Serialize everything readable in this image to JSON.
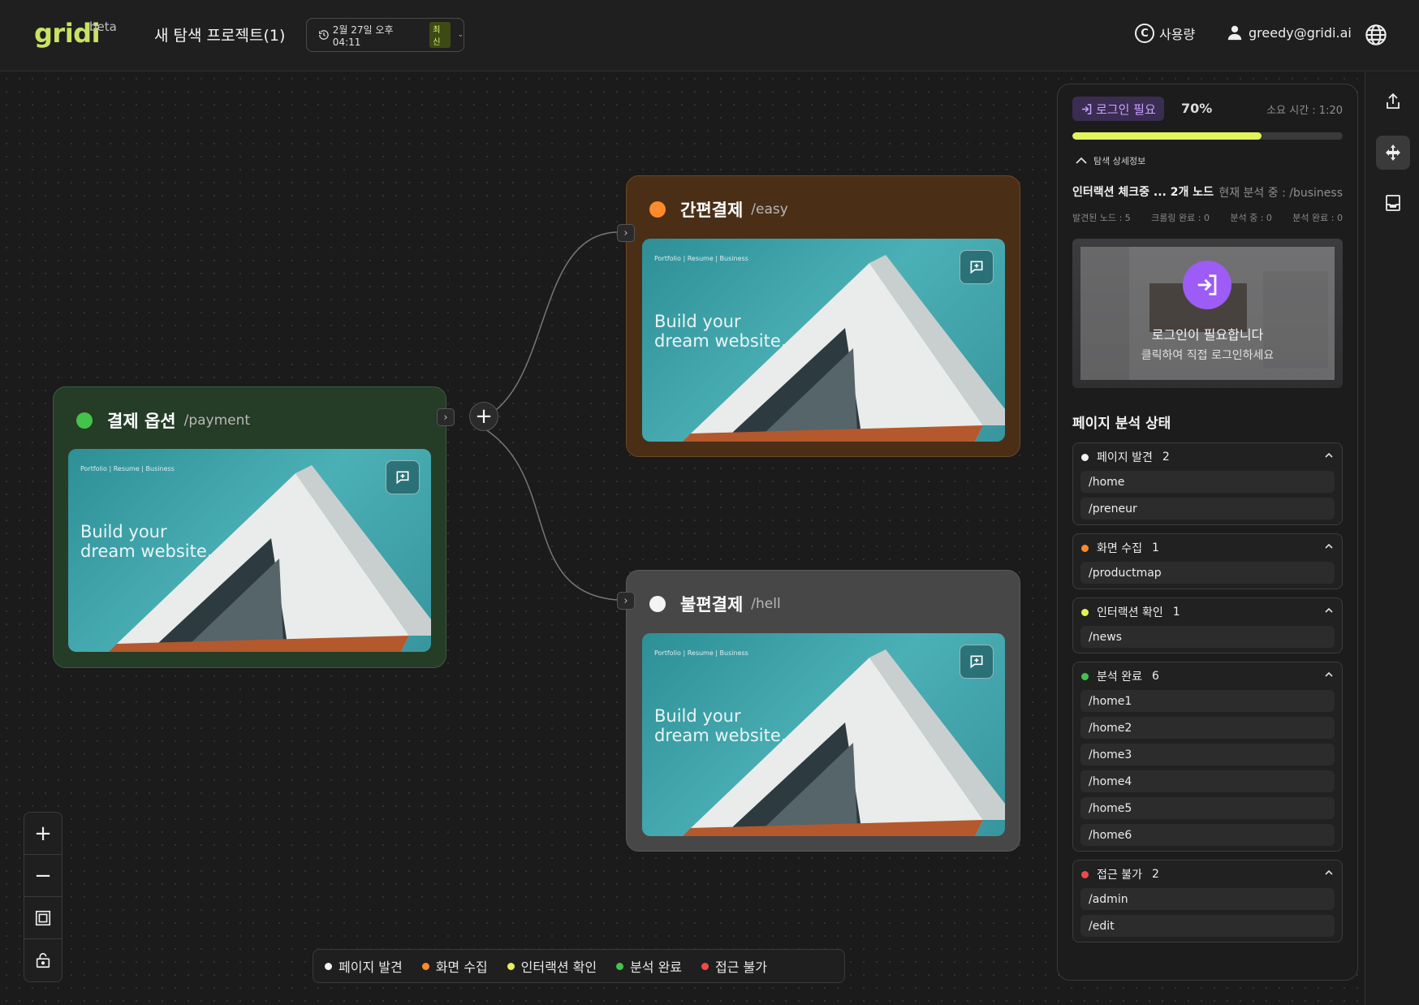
{
  "header": {
    "logo": "gridi",
    "logo_badge": "beta",
    "project_title": "새 탐색 프로젝트(1)",
    "version": {
      "datetime": "2월 27일 오후 04:11",
      "badge": "최신"
    },
    "usage_label": "사용량",
    "user_email": "greedy@gridi.ai"
  },
  "nodes": [
    {
      "id": "payment",
      "name": "결제 옵션",
      "path": "/payment",
      "status_color": "#44c24a",
      "card_color": "#253c27",
      "border_color": "#3c5a3e"
    },
    {
      "id": "easy",
      "name": "간편결제",
      "path": "/easy",
      "status_color": "#ff8a2a",
      "card_color": "#4a2f16",
      "border_color": "#6a4626"
    },
    {
      "id": "hell",
      "name": "불편결제",
      "path": "/hell",
      "status_color": "#f4f4f4",
      "card_color": "#474747",
      "border_color": "#5a5a5a"
    }
  ],
  "thumbnail": {
    "top_text": "Portfolio | Resume | Business",
    "headline": "Build your dream website."
  },
  "legend": [
    {
      "label": "페이지 발견",
      "color": "#f4f4f4"
    },
    {
      "label": "화면 수집",
      "color": "#ff8a2a"
    },
    {
      "label": "인터랙션 확인",
      "color": "#e6f05a"
    },
    {
      "label": "분석 완료",
      "color": "#44c24a"
    },
    {
      "label": "접근 불가",
      "color": "#ef4a4a"
    }
  ],
  "panel": {
    "login_tag": "로그인 필요",
    "percent": "70%",
    "progress": 0.7,
    "elapsed": "소요 시간 : 1:20",
    "detail_toggle": "탐색 상세정보",
    "status_main": "인터랙션 체크중 ... 2개 노드",
    "status_current": "현재 분석 중 : /business",
    "stats": [
      "발견된 노드 : 5",
      "크롤링 완료 : 0",
      "분석 중 : 0",
      "분석 완료 : 0"
    ],
    "login_title": "로그인이 필요합니다",
    "login_sub": "클릭하여 직접 로그인하세요",
    "section_title": "페이지 분석 상태",
    "groups": [
      {
        "label": "페이지 발견",
        "count": "2",
        "color": "#f4f4f4",
        "items": [
          "/home",
          "/preneur"
        ]
      },
      {
        "label": "화면 수집",
        "count": "1",
        "color": "#ff8a2a",
        "items": [
          "/productmap"
        ]
      },
      {
        "label": "인터랙션 확인",
        "count": "1",
        "color": "#e6f05a",
        "items": [
          "/news"
        ]
      },
      {
        "label": "분석 완료",
        "count": "6",
        "color": "#44c24a",
        "items": [
          "/home1",
          "/home2",
          "/home3",
          "/home4",
          "/home5",
          "/home6"
        ]
      },
      {
        "label": "접근 불가",
        "count": "2",
        "color": "#ef4a4a",
        "items": [
          "/admin",
          "/edit"
        ]
      }
    ]
  }
}
